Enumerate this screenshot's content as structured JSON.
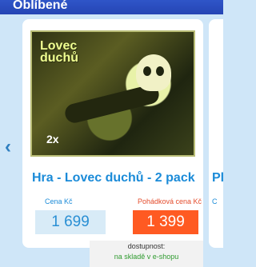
{
  "header": {
    "title": "Oblíbené"
  },
  "carousel": {
    "prev_arrow": "‹",
    "prev_icon": "chevron-left-icon"
  },
  "product": {
    "image_title": "Lovec duchů",
    "image_badge": "2x",
    "name": "Hra - Lovec duchů - 2 pack",
    "regular_label": "Cena Kč",
    "regular_price": "1 699",
    "fairy_label": "Pohádková cena Kč",
    "fairy_price": "1 399",
    "stock_label": "dostupnost:",
    "stock_value": "na skladě v e-shopu",
    "colors": {
      "regular_price_bg": "#d8ebf7",
      "fairy_price_bg": "#ff5a22",
      "title": "#1b8bd8"
    }
  },
  "next_product": {
    "title_fragment": "Pl",
    "label_fragment": "C"
  }
}
